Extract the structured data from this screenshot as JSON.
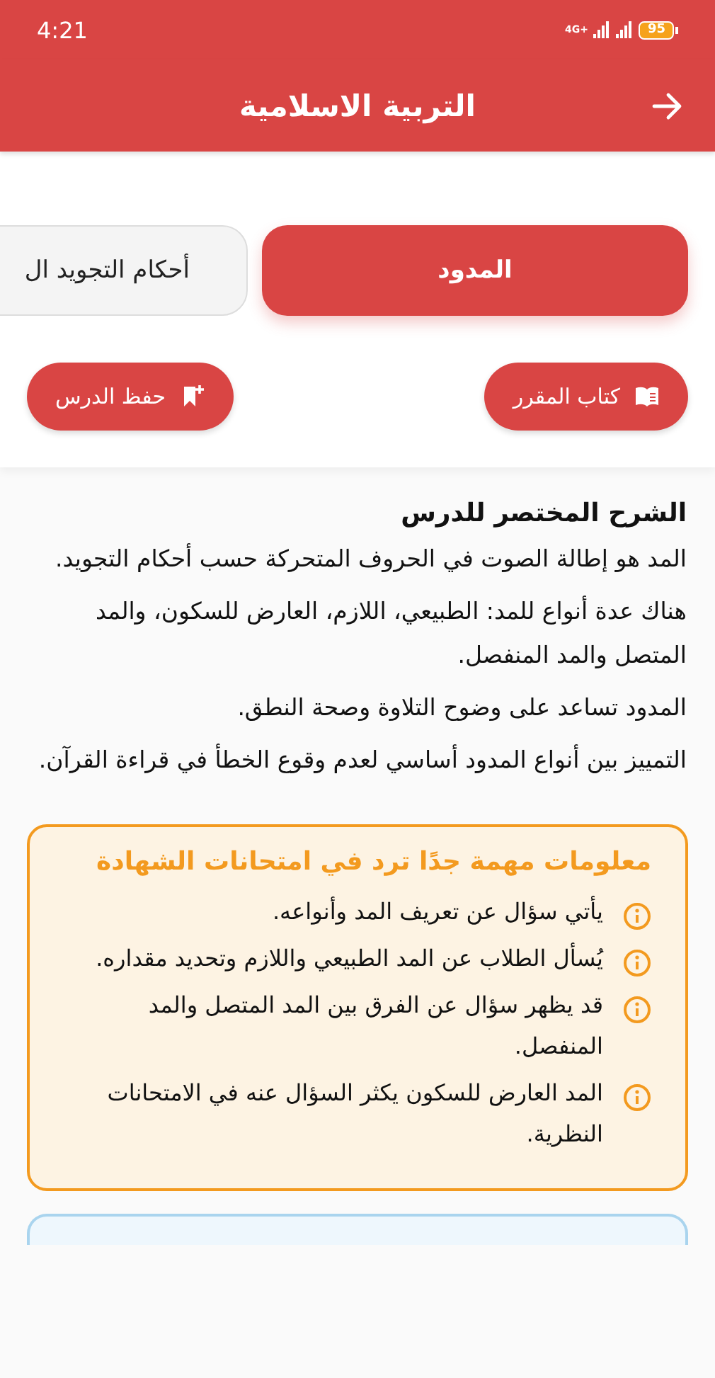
{
  "status_bar": {
    "time": "4:21",
    "network": "4G+",
    "battery": "95"
  },
  "header": {
    "title": "التربية الاسلامية"
  },
  "tabs": [
    {
      "label": "المدود",
      "selected": true
    },
    {
      "label": "أحكام التجويد ال",
      "selected": false
    }
  ],
  "actions": [
    {
      "label": "كتاب المقرر",
      "kind": "book"
    },
    {
      "label": "حفظ الدرس",
      "kind": "bookmark"
    }
  ],
  "lesson": {
    "heading": "الشرح المختصر للدرس",
    "paragraphs": [
      "المد هو إطالة الصوت في الحروف المتحركة حسب أحكام التجويد.",
      "هناك عدة أنواع للمد: الطبيعي، اللازم، العارض للسكون، والمد المتصل والمد المنفصل.",
      "المدود تساعد على وضوح التلاوة وصحة النطق.",
      "التمييز بين أنواع المدود أساسي لعدم وقوع الخطأ في قراءة القرآن."
    ]
  },
  "exam_tips": {
    "title": "معلومات مهمة جدًا ترد في امتحانات الشهادة",
    "items": [
      "يأتي سؤال عن تعريف المد وأنواعه.",
      "يُسأل الطلاب عن المد الطبيعي واللازم وتحديد مقداره.",
      "قد يظهر سؤال عن الفرق بين المد المتصل والمد المنفصل.",
      "المد العارض للسكون يكثر السؤال عنه في الامتحانات النظرية."
    ]
  }
}
